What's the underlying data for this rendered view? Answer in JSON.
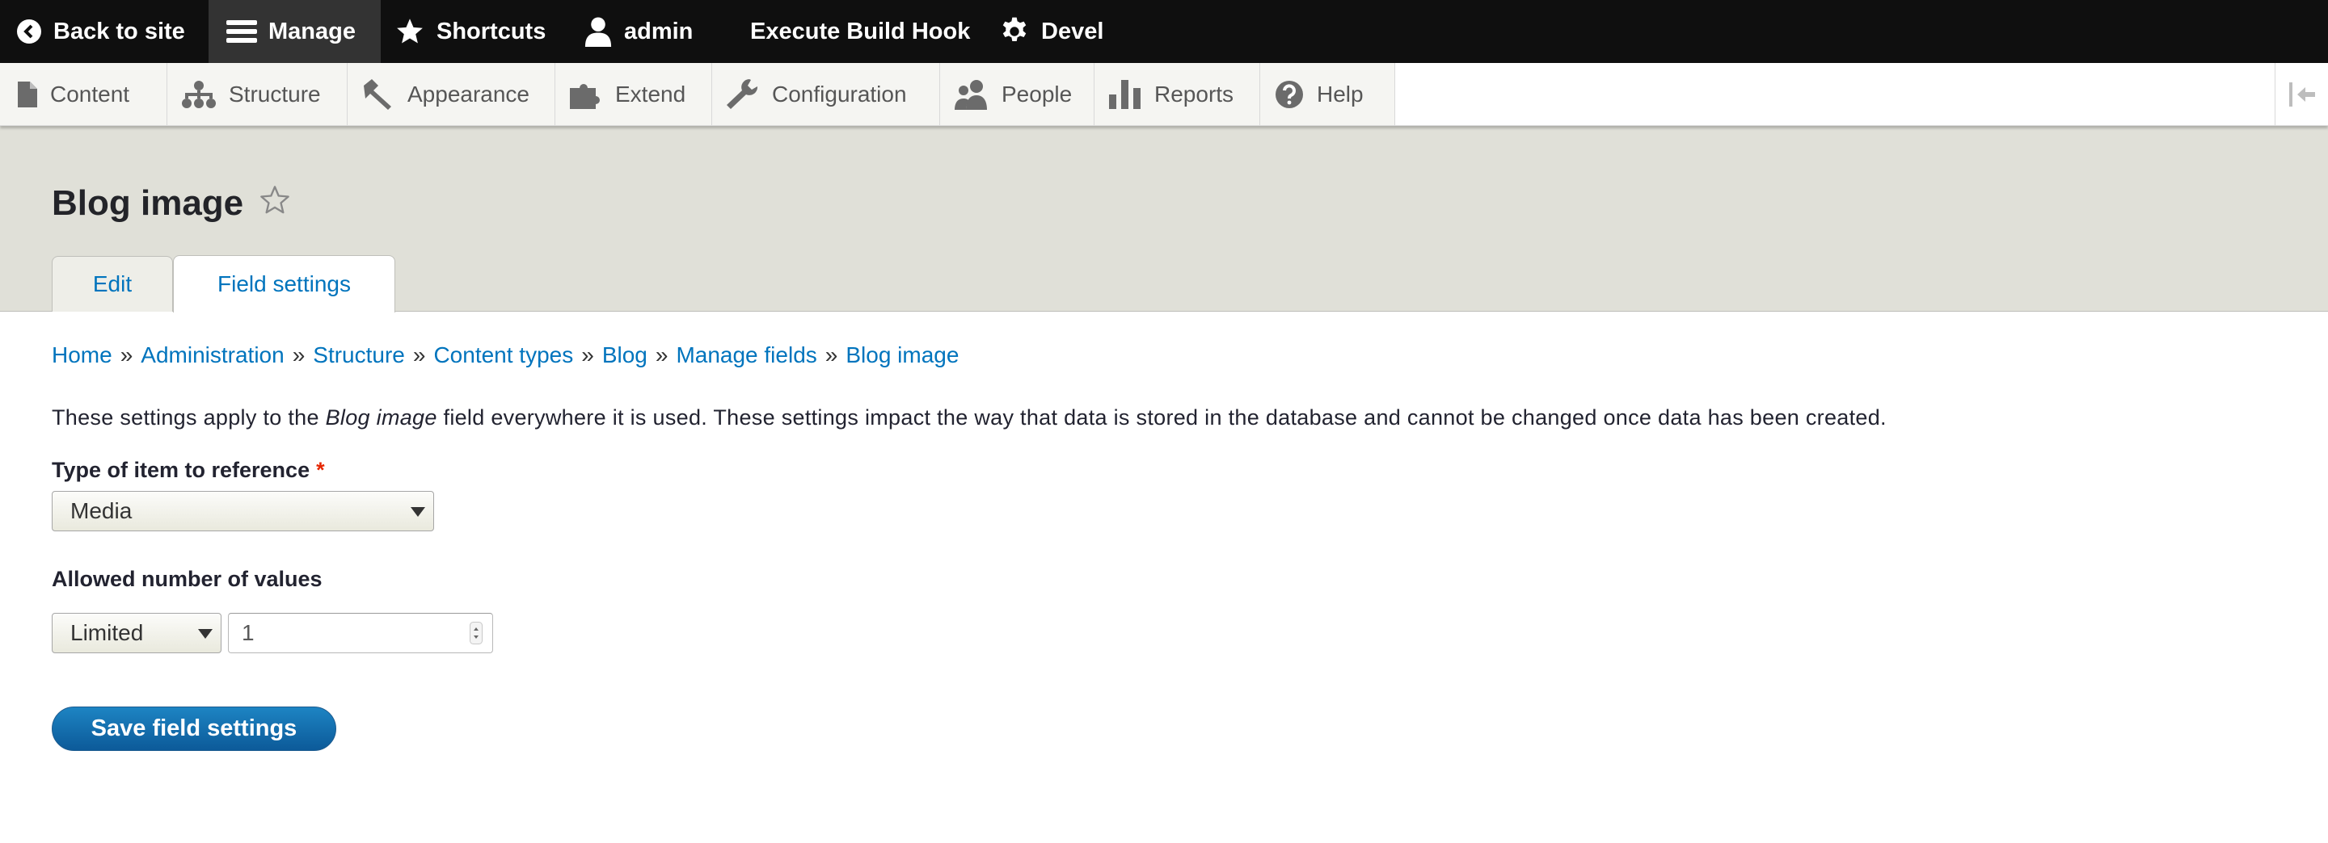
{
  "toolbar": {
    "back_to_site": "Back to site",
    "manage": "Manage",
    "shortcuts": "Shortcuts",
    "user": "admin",
    "execute_build_hook": "Execute Build Hook",
    "devel": "Devel"
  },
  "tray": {
    "items": [
      {
        "label": "Content",
        "icon": "file-icon"
      },
      {
        "label": "Structure",
        "icon": "sitemap-icon"
      },
      {
        "label": "Appearance",
        "icon": "paintbrush-icon"
      },
      {
        "label": "Extend",
        "icon": "puzzle-icon"
      },
      {
        "label": "Configuration",
        "icon": "wrench-icon"
      },
      {
        "label": "People",
        "icon": "people-icon"
      },
      {
        "label": "Reports",
        "icon": "bar-chart-icon"
      },
      {
        "label": "Help",
        "icon": "help-icon"
      }
    ]
  },
  "page": {
    "title": "Blog image",
    "tabs": [
      {
        "label": "Edit",
        "active": false
      },
      {
        "label": "Field settings",
        "active": true
      }
    ]
  },
  "breadcrumb": [
    "Home",
    "Administration",
    "Structure",
    "Content types",
    "Blog",
    "Manage fields",
    "Blog image"
  ],
  "breadcrumb_separator": "»",
  "info": {
    "prefix": "These settings apply to the",
    "field_name": "Blog image",
    "suffix": "field everywhere it is used. These settings impact the way that data is stored in the database and cannot be changed once data has been created."
  },
  "form": {
    "reference_type": {
      "label": "Type of item to reference",
      "required_marker": "*",
      "value": "Media"
    },
    "cardinality": {
      "label": "Allowed number of values",
      "select_value": "Limited",
      "number_value": "1"
    },
    "submit_label": "Save field settings"
  },
  "colors": {
    "toolbar_bg": "#0f0f0f",
    "link": "#0074bd",
    "header_bg": "#e0e0d8",
    "button": "#0c5a99",
    "required": "#e62600"
  }
}
